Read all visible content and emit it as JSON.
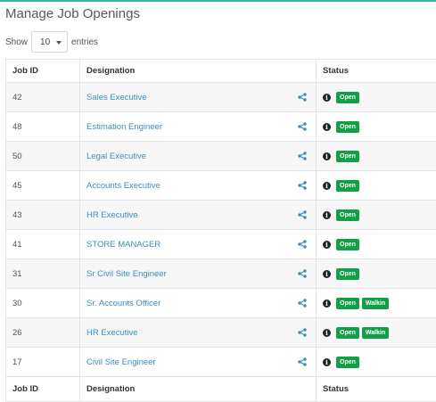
{
  "page": {
    "title": "Manage Job Openings"
  },
  "length_control": {
    "show_label": "Show",
    "selected": "10",
    "entries_label": "entries"
  },
  "table": {
    "headers": {
      "id": "Job ID",
      "designation": "Designation",
      "status": "Status"
    },
    "rows": [
      {
        "id": "42",
        "designation": "Sales Executive",
        "badges": [
          "Open"
        ]
      },
      {
        "id": "48",
        "designation": "Estimation Engineer",
        "badges": [
          "Open"
        ]
      },
      {
        "id": "50",
        "designation": "Legal Executive",
        "badges": [
          "Open"
        ]
      },
      {
        "id": "45",
        "designation": "Accounts Executive",
        "badges": [
          "Open"
        ]
      },
      {
        "id": "43",
        "designation": "HR Executive",
        "badges": [
          "Open"
        ]
      },
      {
        "id": "41",
        "designation": "STORE MANAGER",
        "badges": [
          "Open"
        ]
      },
      {
        "id": "31",
        "designation": "Sr Civil Site Engineer",
        "badges": [
          "Open"
        ]
      },
      {
        "id": "30",
        "designation": "Sr. Accounts Officer",
        "badges": [
          "Open",
          "Walkin"
        ]
      },
      {
        "id": "26",
        "designation": "HR Executive",
        "badges": [
          "Open",
          "Walkin"
        ]
      },
      {
        "id": "17",
        "designation": "Civil Site Engineer",
        "badges": [
          "Open"
        ]
      }
    ],
    "footer": {
      "id": "Job ID",
      "designation": "Designation",
      "status": "Status"
    }
  },
  "icons": {
    "share": "share-icon",
    "info": "info-icon",
    "info_glyph": "i"
  },
  "colors": {
    "link": "#3c8dbc",
    "badge": "#139f48",
    "accent_line": "#3fb0ac"
  }
}
